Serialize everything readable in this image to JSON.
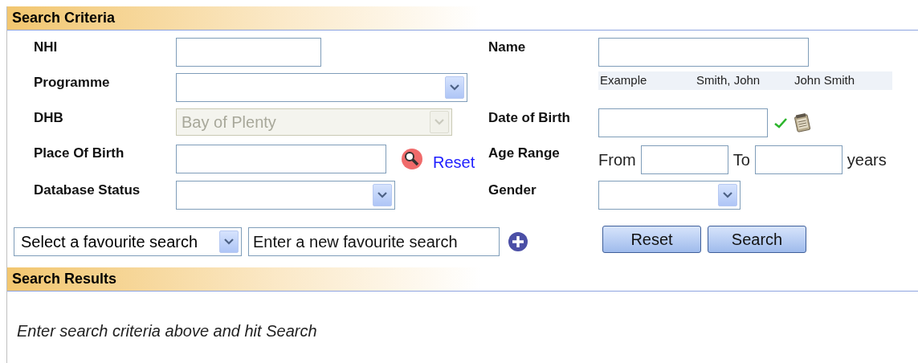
{
  "criteria": {
    "title": "Search Criteria",
    "nhi": {
      "label": "NHI"
    },
    "name": {
      "label": "Name"
    },
    "programme": {
      "label": "Programme",
      "disabled": false
    },
    "name_example": [
      "Example",
      "Smith, John",
      "John Smith"
    ],
    "dhb": {
      "label": "DHB",
      "value": "Bay of Plenty",
      "disabled": true
    },
    "date_of_birth": {
      "label": "Date of Birth"
    },
    "place_of_birth": {
      "label": "Place Of Birth",
      "link": "Reset"
    },
    "age_range": {
      "label": "Age Range",
      "from": "From",
      "to": "To",
      "unit": "years"
    },
    "database_status": {
      "label": "Database Status",
      "disabled": false
    },
    "gender": {
      "label": "Gender",
      "disabled": false
    },
    "favourite": {
      "select": "Select a favourite search",
      "placeholder": "Enter a new favourite search"
    },
    "buttons": [
      "Reset",
      "Search"
    ]
  },
  "results": {
    "title": "Search Results",
    "message": "Enter search criteria above and hit Search"
  }
}
